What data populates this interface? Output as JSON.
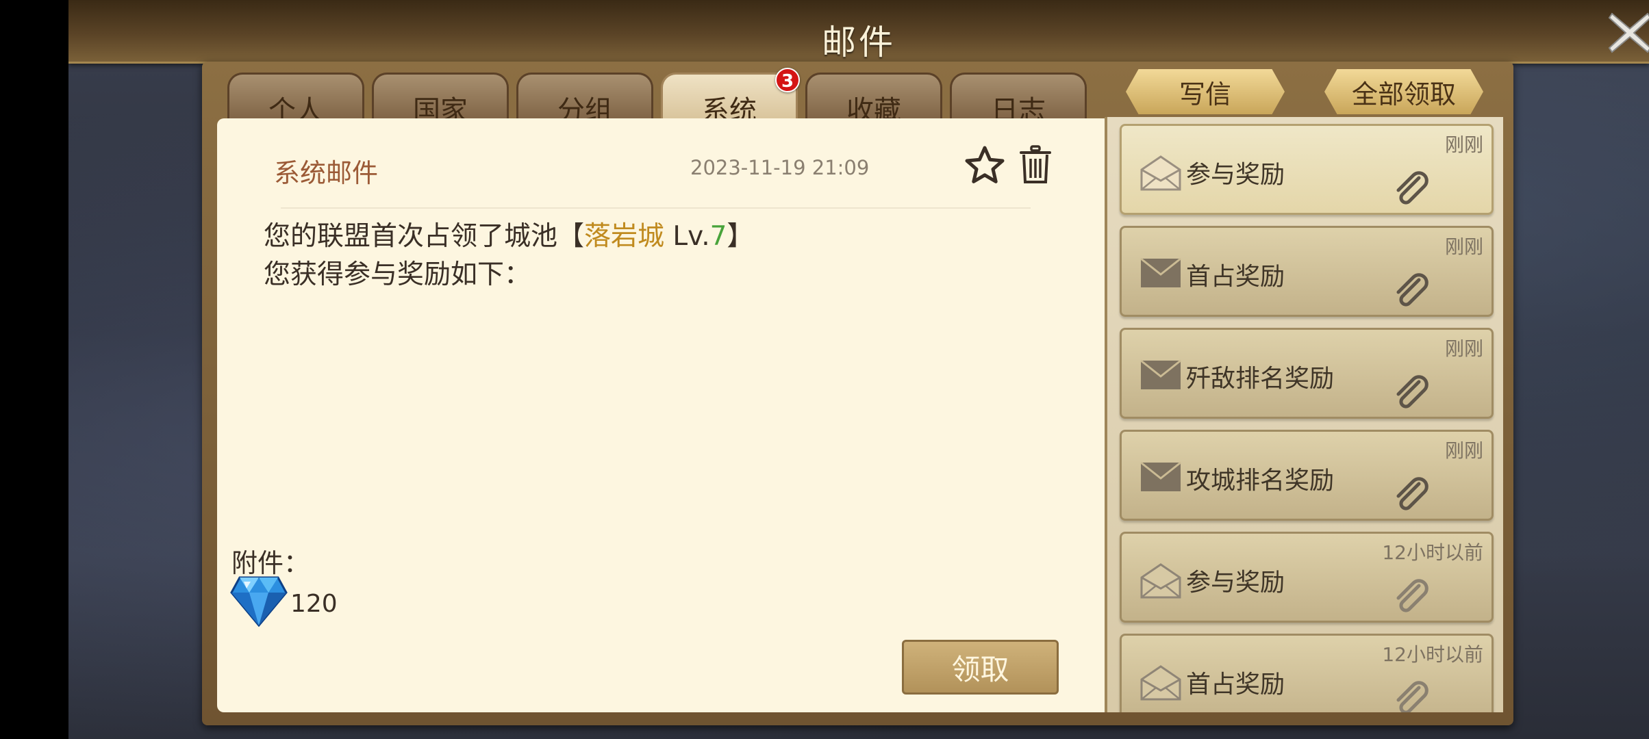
{
  "window": {
    "title": "邮件",
    "close_icon": "close-x-icon"
  },
  "tabs": [
    {
      "label": "个人",
      "active": false
    },
    {
      "label": "国家",
      "active": false
    },
    {
      "label": "分组",
      "active": false
    },
    {
      "label": "系统",
      "active": true,
      "badge": "3"
    },
    {
      "label": "收藏",
      "active": false
    },
    {
      "label": "日志",
      "active": false
    }
  ],
  "actions": {
    "write_label": "写信",
    "claim_all_label": "全部领取"
  },
  "mail": {
    "from": "系统邮件",
    "date": "2023-11-19 21:09",
    "line1_prefix": "您的联盟首次占领了城池【",
    "city": "落岩城",
    "level_prefix": " Lv.",
    "level": "7",
    "line1_suffix": "】",
    "line2": "您获得参与奖励如下：",
    "attachment_label": "附件：",
    "attachment_icon": "blue-diamond-icon",
    "attachment_count": "120",
    "claim_label": "领取"
  },
  "mail_list": [
    {
      "title": "参与奖励",
      "time": "刚刚",
      "unread": true,
      "icon": "open-envelope-icon"
    },
    {
      "title": "首占奖励",
      "time": "刚刚",
      "unread": false,
      "icon": "closed-envelope-icon"
    },
    {
      "title": "歼敌排名奖励",
      "time": "刚刚",
      "unread": false,
      "icon": "closed-envelope-icon"
    },
    {
      "title": "攻城排名奖励",
      "time": "刚刚",
      "unread": false,
      "icon": "closed-envelope-icon"
    },
    {
      "title": "参与奖励",
      "time": "12小时以前",
      "unread": false,
      "icon": "open-envelope-icon"
    },
    {
      "title": "首占奖励",
      "time": "12小时以前",
      "unread": false,
      "icon": "open-envelope-icon"
    }
  ],
  "colors": {
    "brown_header": "#5a4326",
    "paper": "#fdf6e0",
    "city_text": "#c08a1e",
    "level_text": "#48a33a",
    "badge_red": "#d41515"
  }
}
